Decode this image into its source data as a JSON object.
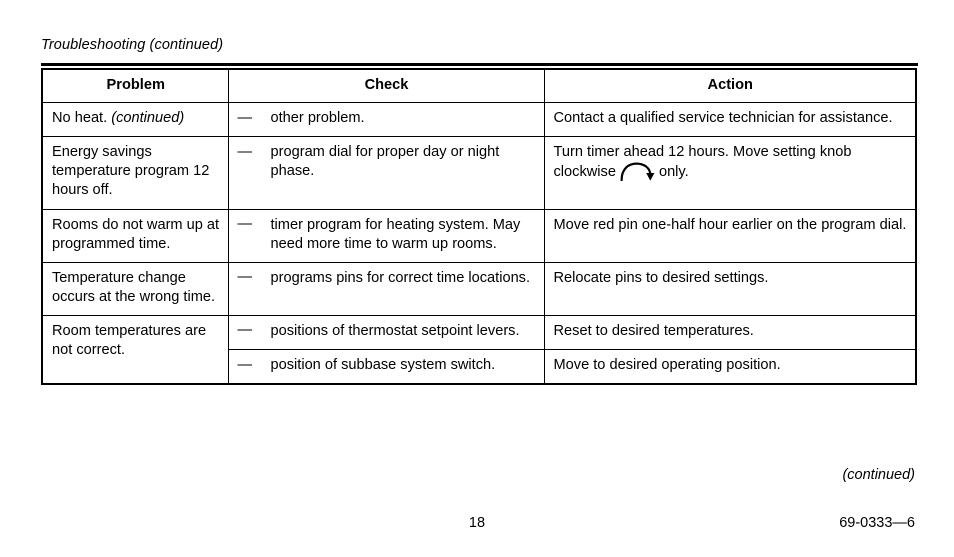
{
  "document": {
    "section_title": "Troubleshooting (continued)",
    "continued_note": "(continued)",
    "page_number": "18",
    "doc_code": "69-0333—6"
  },
  "table": {
    "headers": {
      "problem": "Problem",
      "check": "Check",
      "action": "Action"
    },
    "bullet": "—",
    "rows": [
      {
        "problem_plain": "No heat. ",
        "problem_italic": "(continued)",
        "check": "other problem.",
        "action": "Contact a qualified service technician for assistance."
      },
      {
        "problem_plain": "Energy savings temperature program 12 hours off.",
        "problem_italic": "",
        "check": "program dial for proper day or night phase.",
        "action_before": "Turn timer ahead 12 hours. Move setting knob clockwise",
        "action_icon": "clockwise-rotation-arrow-icon",
        "action_after": "only."
      },
      {
        "problem_plain": "Rooms do not warm up at programmed time.",
        "problem_italic": "",
        "check": "timer program for heating system. May need more time to warm up rooms.",
        "action": "Move red pin one-half hour earlier on the program dial."
      },
      {
        "problem_plain": "Temperature change occurs at the wrong time.",
        "problem_italic": "",
        "check": "programs pins for correct time locations.",
        "action": "Relocate pins to desired settings."
      },
      {
        "problem_plain": "Room temperatures are not correct.",
        "problem_italic": "",
        "check": "positions of thermostat setpoint levers.",
        "action": "Reset to desired temperatures."
      },
      {
        "problem_plain": "",
        "problem_italic": "",
        "check": "position of subbase system switch.",
        "action": "Move to desired operating position."
      }
    ]
  },
  "colors": {
    "ink": "#000000",
    "paper": "#ffffff"
  }
}
